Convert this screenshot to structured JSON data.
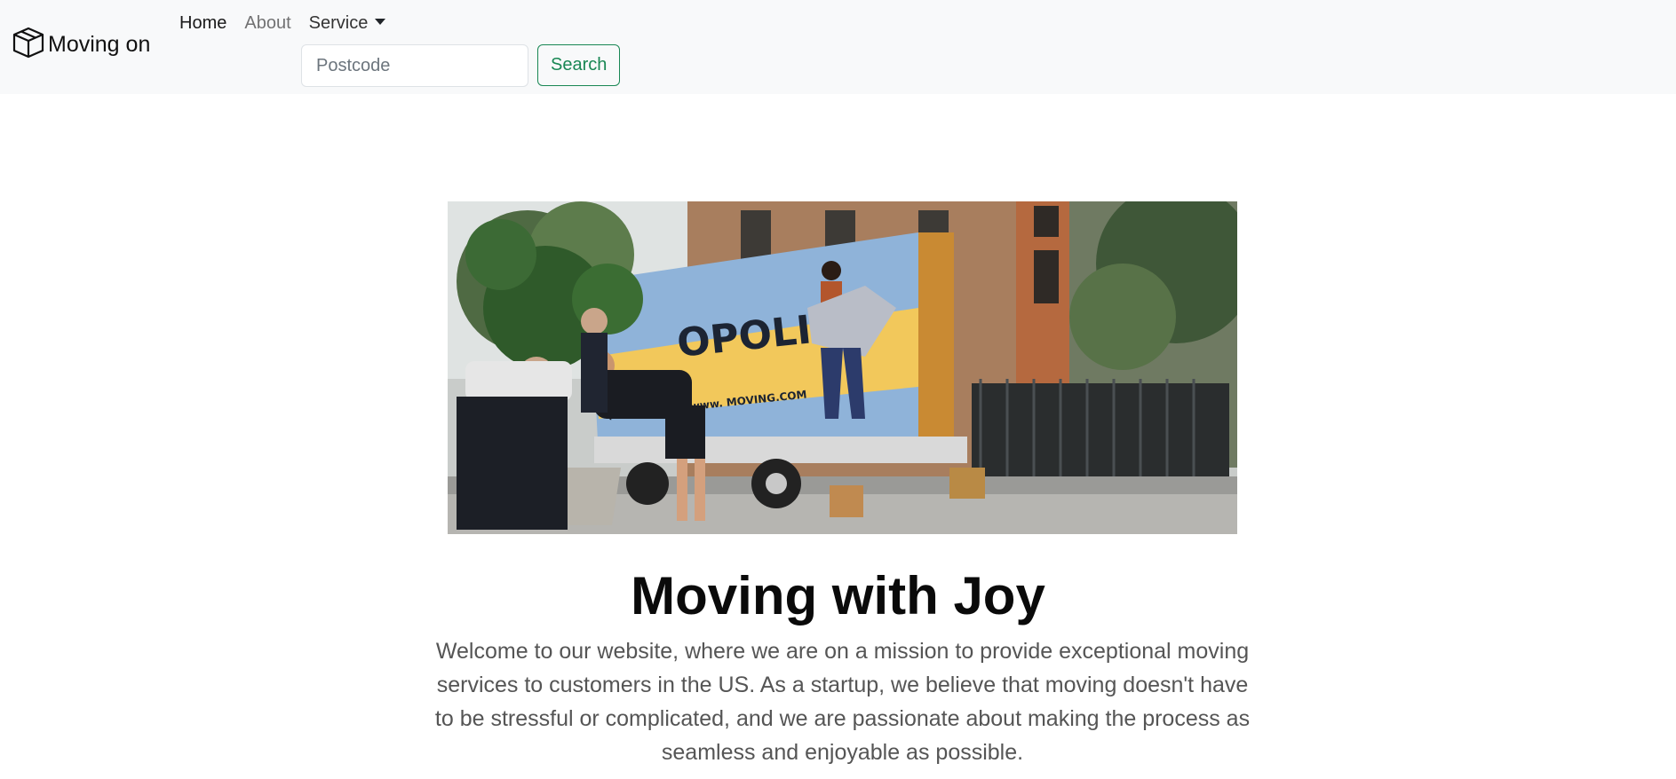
{
  "brand": {
    "name": "Moving on",
    "icon": "box-icon"
  },
  "nav": {
    "home": "Home",
    "about": "About",
    "service": "Service"
  },
  "search": {
    "placeholder": "Postcode",
    "value": "",
    "button_label": "Search"
  },
  "hero": {
    "image_alt": "Movers loading a moving truck",
    "truck_text_1": "OPOLIS",
    "truck_text_2": "(718) 7 520 • www.          MOVING.COM",
    "title": "Moving with Joy",
    "lead": "Welcome to our website, where we are on a mission to provide exceptional moving services to customers in the US. As a startup, we believe that moving doesn't have to be stressful or complicated, and we are passionate about making the process as seamless and enjoyable as possible."
  },
  "colors": {
    "navbar_bg": "#f8f9fa",
    "accent_success": "#198754",
    "truck_blue": "#8fb3d9",
    "truck_yellow": "#f2c85b"
  }
}
